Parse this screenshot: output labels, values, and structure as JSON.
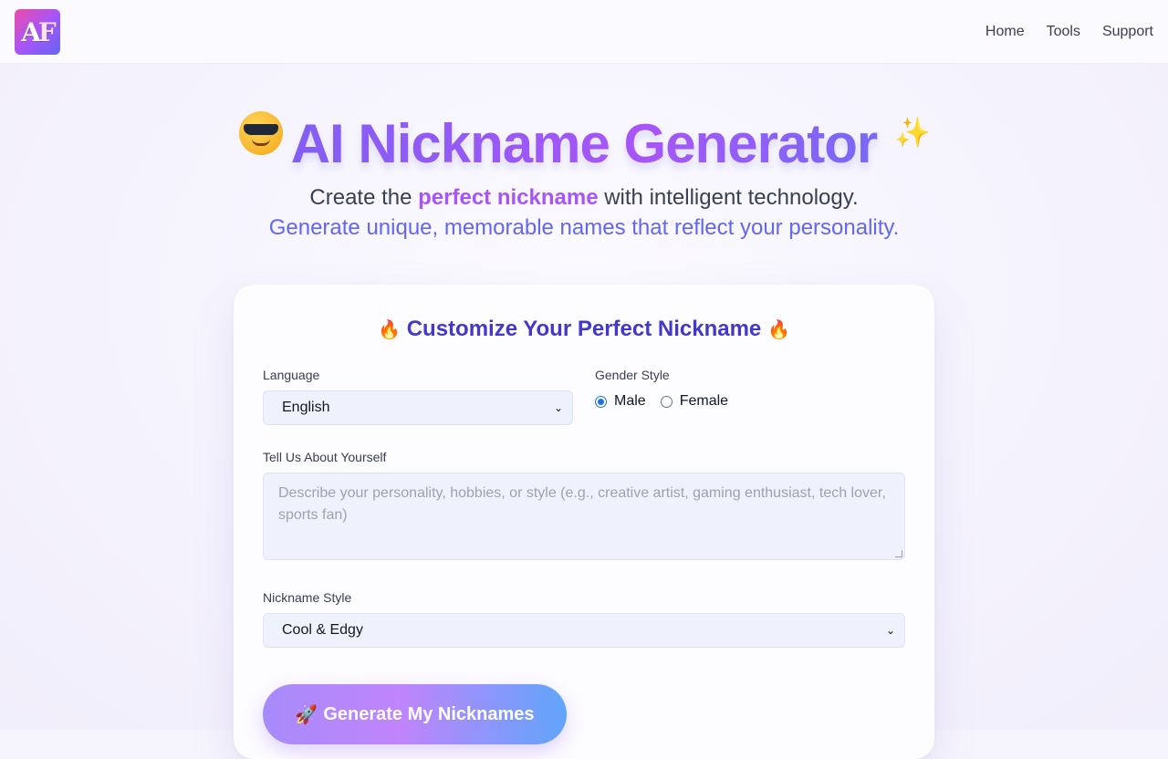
{
  "header": {
    "logo_text_a": "A",
    "logo_text_f": "F",
    "nav": [
      {
        "label": "Home"
      },
      {
        "label": "Tools"
      },
      {
        "label": "Support"
      }
    ]
  },
  "hero": {
    "emoji_left": "sunglasses-face-icon",
    "title": "AI Nickname Generator",
    "sparkle": "✨",
    "subtitle_pre": "Create the ",
    "subtitle_highlight": "perfect nickname",
    "subtitle_post": " with intelligent technology.",
    "subtitle2": "Generate unique, memorable names that reflect your personality."
  },
  "form": {
    "title": "Customize Your Perfect Nickname",
    "fire": "🔥",
    "language_label": "Language",
    "language_value": "English",
    "gender_label": "Gender Style",
    "gender_options": [
      {
        "label": "Male",
        "selected": true
      },
      {
        "label": "Female",
        "selected": false
      }
    ],
    "about_label": "Tell Us About Yourself",
    "about_placeholder": "Describe your personality, hobbies, or style (e.g., creative artist, gaming enthusiast, tech lover, sports fan)",
    "style_label": "Nickname Style",
    "style_value": "Cool & Edgy",
    "generate_label": "Generate My Nicknames",
    "generate_icon": "🚀"
  },
  "colors": {
    "accent_indigo": "#6366f1",
    "accent_purple": "#a855f7",
    "title_blue": "#4338ca"
  }
}
